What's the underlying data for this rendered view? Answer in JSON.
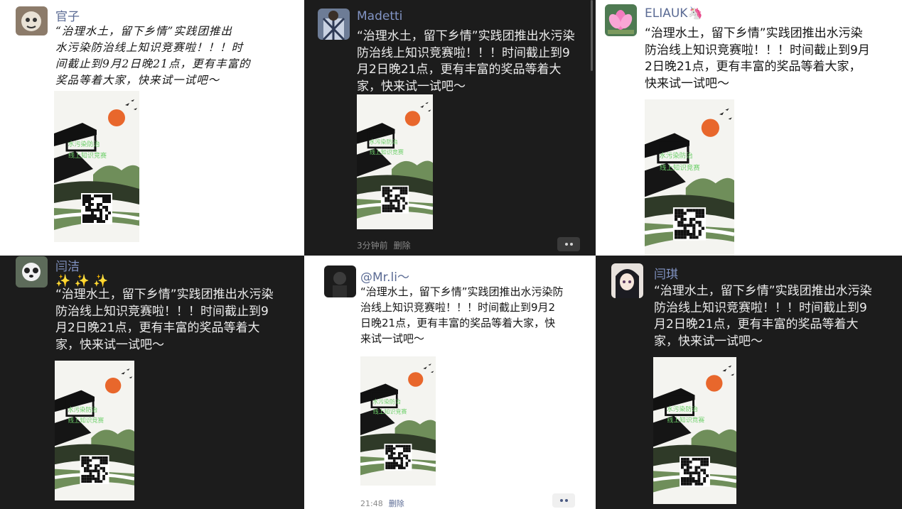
{
  "post_text": "“治理水土，留下乡情”实践团推出水污染防治线上知识竞赛啦！！！时间截止到9月2日晚21点，更有丰富的奖品等着大家，快来试一试吧～",
  "poster": {
    "line1": "水污染防治",
    "line2": "线上知识竞赛"
  },
  "posts": [
    {
      "name": "官子",
      "text": "“治理水土，留下乡情”实践团推出\n水污染防治线上知识竞赛啦！！！时\n间截止到9月2日晚21点，更有丰富的\n奖品等着大家，快来试一试吧～"
    },
    {
      "name": "Madetti",
      "text": "“治理水土，留下乡情”实践团推出水污染\n防治线上知识竞赛啦！！！时间截止到9\n月2日晚21点，更有丰富的奖品等着大\n家，快来试一试吧～",
      "time": "3分钟前",
      "delete": "删除"
    },
    {
      "name": "ELIAUK🦄",
      "text": "“治理水土，留下乡情”实践团推出水污染\n防治线上知识竞赛啦！！！时间截止到9月\n2日晚21点，更有丰富的奖品等着大家，\n快来试一试吧～"
    },
    {
      "name": "闫洁",
      "emoji": "✨ ✨ ✨",
      "text": "“治理水土，留下乡情”实践团推出水污染\n防治线上知识竞赛啦！！！时间截止到9\n月2日晚21点，更有丰富的奖品等着大\n家，快来试一试吧～"
    },
    {
      "name": "@Mr.li～",
      "text": "“治理水土，留下乡情”实践团推出水污染防\n治线上知识竞赛啦！！！时间截止到9月2\n日晚21点，更有丰富的奖品等着大家，快\n来试一试吧～",
      "time": "21:48",
      "delete": "删除"
    },
    {
      "name": "闫琪",
      "text": "“治理水土，留下乡情”实践团推出水污染\n防治线上知识竞赛啦！！！时间截止到9\n月2日晚21点，更有丰富的奖品等着大\n家，快来试一试吧～"
    }
  ],
  "colors": {
    "sun": "#e8672c",
    "green": "#6f8e5a",
    "dark_green": "#2f3a28",
    "link": "#5b6b94"
  },
  "icons": {
    "more": "more-dots-icon"
  }
}
